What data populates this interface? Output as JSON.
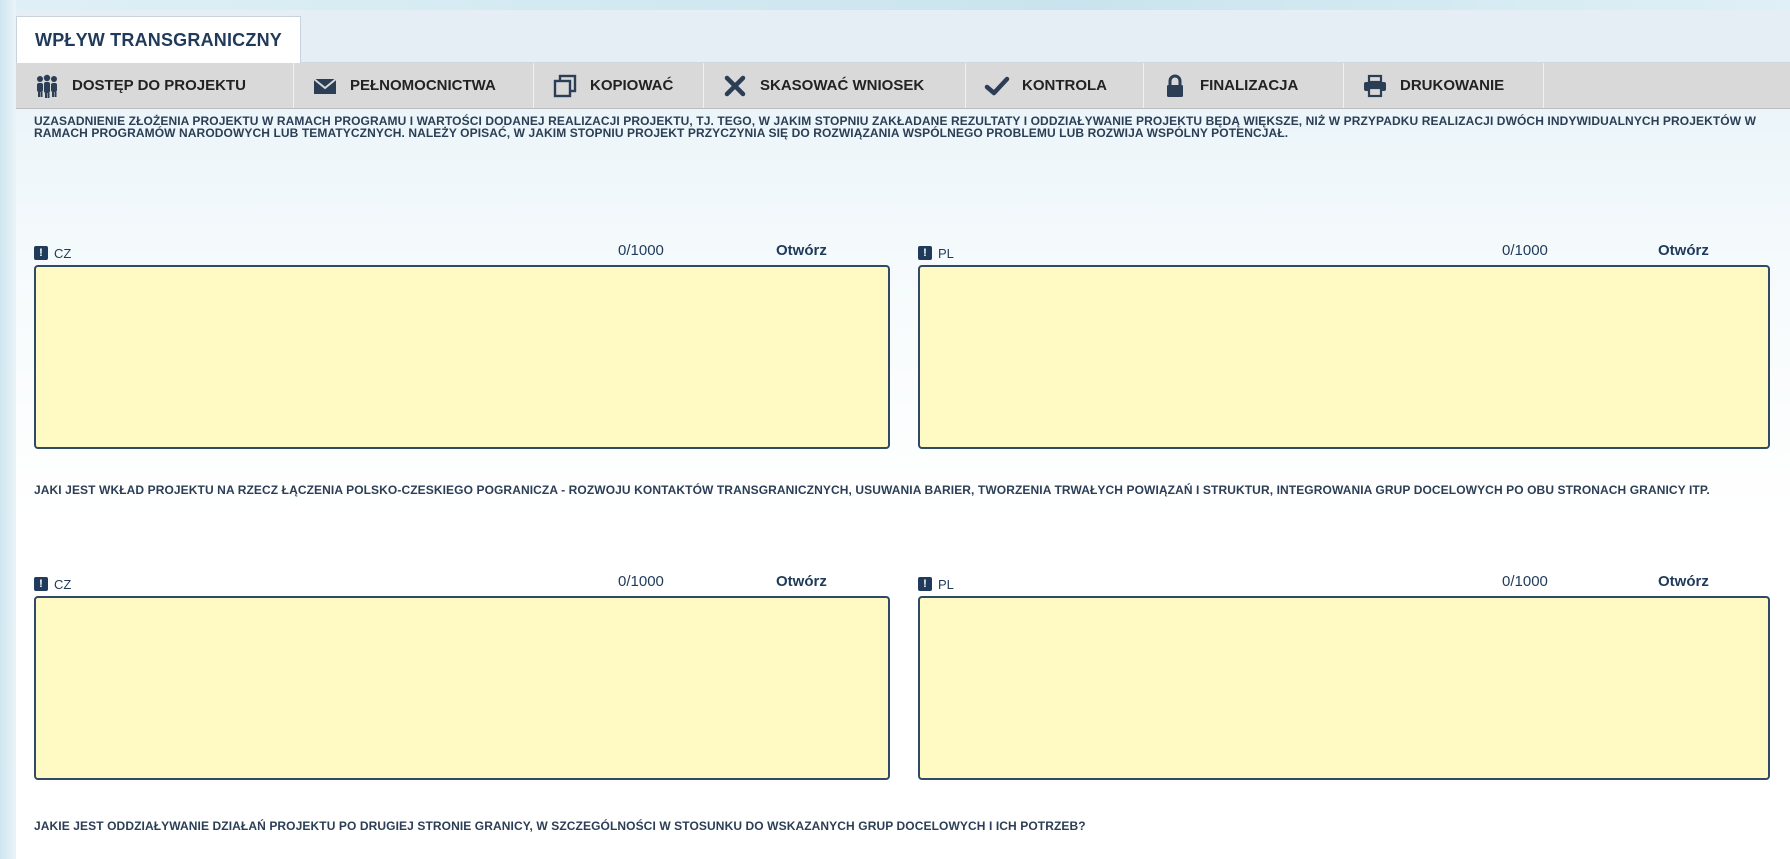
{
  "header": {
    "tab_title": "WPŁYW TRANSGRANICZNY"
  },
  "toolbar": {
    "buttons": [
      {
        "label": "DOSTĘP DO PROJEKTU",
        "icon": "users-icon"
      },
      {
        "label": "PEŁNOMOCNICTWA",
        "icon": "envelope-icon"
      },
      {
        "label": "KOPIOWAĆ",
        "icon": "copy-icon"
      },
      {
        "label": "SKASOWAĆ WNIOSEK",
        "icon": "delete-icon"
      },
      {
        "label": "KONTROLA",
        "icon": "check-icon"
      },
      {
        "label": "FINALIZACJA",
        "icon": "lock-icon"
      },
      {
        "label": "DRUKOWANIE",
        "icon": "printer-icon"
      }
    ]
  },
  "sections": [
    {
      "question": "UZASADNIENIE ZŁOŻENIA PROJEKTU W RAMACH PROGRAMU I WARTOŚCI DODANEJ REALIZACJI PROJEKTU, TJ. TEGO, W JAKIM STOPNIU ZAKŁADANE REZULTATY I ODDZIAŁYWANIE PROJEKTU BĘDĄ WIĘKSZE, NIŻ W PRZYPADKU REALIZACJI DWÓCH INDYWIDUALNYCH PROJEKTÓW W RAMACH PROGRAMÓW NARODOWYCH LUB TEMATYCZNYCH. NALEŻY OPISAĆ, W JAKIM STOPNIU PROJEKT PRZYCZYNIA SIĘ DO ROZWIĄZANIA WSPÓLNEGO PROBLEMU LUB ROZWIJA WSPÓLNY POTENCJAŁ.",
      "fields": [
        {
          "badge": "!",
          "lang": "CZ",
          "counter": "0/1000",
          "open": "Otwórz",
          "value": ""
        },
        {
          "badge": "!",
          "lang": "PL",
          "counter": "0/1000",
          "open": "Otwórz",
          "value": ""
        }
      ]
    },
    {
      "question": "JAKI JEST WKŁAD PROJEKTU NA RZECZ ŁĄCZENIA POLSKO-CZESKIEGO POGRANICZA - ROZWOJU KONTAKTÓW TRANSGRANICZNYCH, USUWANIA BARIER, TWORZENIA TRWAŁYCH POWIĄZAŃ I STRUKTUR, INTEGROWANIA GRUP DOCELOWYCH PO OBU STRONACH GRANICY ITP.",
      "fields": [
        {
          "badge": "!",
          "lang": "CZ",
          "counter": "0/1000",
          "open": "Otwórz",
          "value": ""
        },
        {
          "badge": "!",
          "lang": "PL",
          "counter": "0/1000",
          "open": "Otwórz",
          "value": ""
        }
      ]
    },
    {
      "question": "JAKIE JEST ODDZIAŁYWANIE DZIAŁAŃ PROJEKTU PO DRUGIEJ STRONIE GRANICY, W SZCZEGÓLNOŚCI W STOSUNKU DO WSKAZANYCH GRUP DOCELOWYCH I ICH POTRZEB?"
    }
  ],
  "colors": {
    "toolbar_bg": "#d9d9d9",
    "textbox_bg": "#fff9c4",
    "textbox_border": "#2e4a66",
    "text_primary": "#1f3a5a"
  }
}
